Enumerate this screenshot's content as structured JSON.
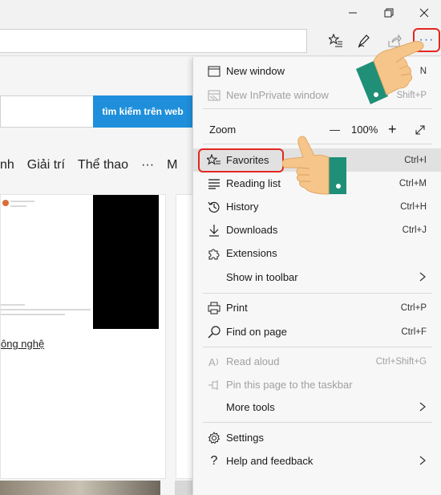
{
  "window": {
    "minimize_icon": "minimize-icon",
    "restore_icon": "restore-icon",
    "close_icon": "close-icon"
  },
  "toolbar": {
    "address_value": "",
    "more_label": "···"
  },
  "page": {
    "search_button": "tìm kiếm trên web",
    "nav": [
      "nh",
      "Giải trí",
      "Thể thao",
      "···",
      "M"
    ],
    "tech_link": "ông nghệ"
  },
  "menu": {
    "new_window": {
      "label": "New window",
      "shortcut": "N"
    },
    "inprivate": {
      "label": "New InPrivate window",
      "shortcut": "Shift+P"
    },
    "zoom": {
      "label": "Zoom",
      "minus": "—",
      "value": "100%",
      "plus": "+"
    },
    "favorites": {
      "label": "Favorites",
      "shortcut": "Ctrl+I"
    },
    "reading_list": {
      "label": "Reading list",
      "shortcut": "Ctrl+M"
    },
    "history": {
      "label": "History",
      "shortcut": "Ctrl+H"
    },
    "downloads": {
      "label": "Downloads",
      "shortcut": "Ctrl+J"
    },
    "extensions": {
      "label": "Extensions"
    },
    "show_in_toolbar": {
      "label": "Show in toolbar"
    },
    "print": {
      "label": "Print",
      "shortcut": "Ctrl+P"
    },
    "find": {
      "label": "Find on page",
      "shortcut": "Ctrl+F"
    },
    "read_aloud": {
      "label": "Read aloud",
      "shortcut": "Ctrl+Shift+G"
    },
    "pin": {
      "label": "Pin this page to the taskbar"
    },
    "more_tools": {
      "label": "More tools"
    },
    "settings": {
      "label": "Settings"
    },
    "help": {
      "label": "Help and feedback"
    }
  },
  "colors": {
    "highlight_border": "#e2271f",
    "search_button_bg": "#1f8fdb",
    "more_dots": "#3a6bc9",
    "cuff": "#1f8f78",
    "skin": "#f6c58a"
  }
}
